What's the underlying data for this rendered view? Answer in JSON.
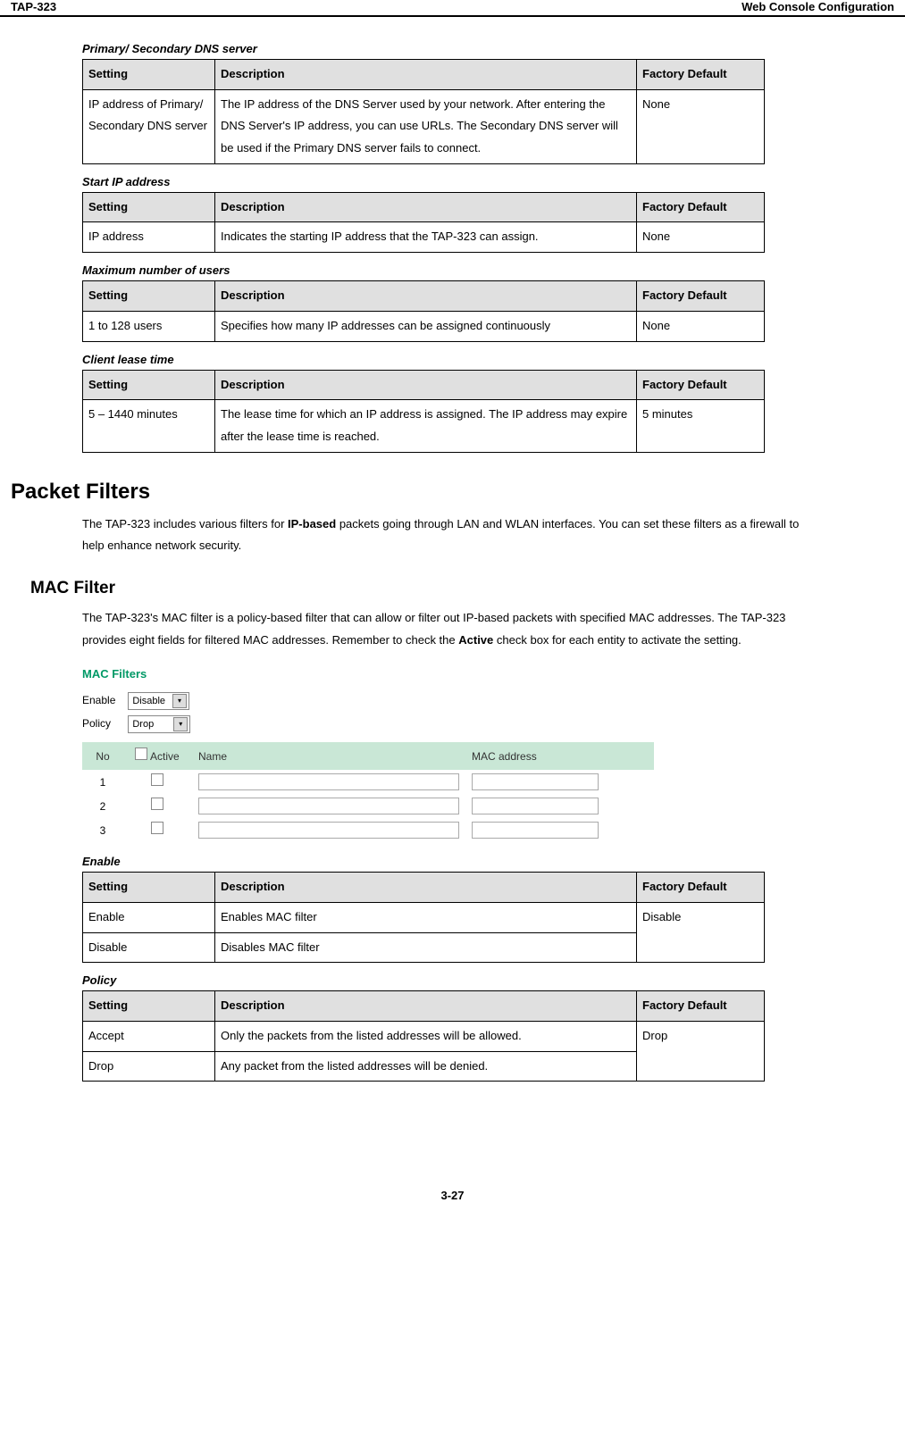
{
  "header": {
    "left": "TAP-323",
    "right": "Web Console Configuration"
  },
  "tables": {
    "headers": {
      "setting": "Setting",
      "description": "Description",
      "default": "Factory Default"
    },
    "dns": {
      "title": "Primary/ Secondary DNS server",
      "setting": "IP address of Primary/ Secondary DNS server",
      "description": "The IP address of the DNS Server used by your network. After entering the DNS Server's IP address, you can use URLs. The Secondary DNS server will be used if the Primary DNS server fails to connect.",
      "default": "None"
    },
    "start_ip": {
      "title": "Start IP address",
      "setting": "IP address",
      "description": "Indicates the starting IP address that the TAP-323 can assign.",
      "default": "None"
    },
    "max_users": {
      "title": "Maximum number of users",
      "setting": "1 to 128 users",
      "description": "Specifies how many IP addresses can be assigned continuously",
      "default": "None"
    },
    "lease": {
      "title": "Client lease time",
      "setting": "5 – 1440 minutes",
      "description": "The lease time for which an IP address is assigned. The IP address may expire after the lease time is reached.",
      "default": "5 minutes"
    },
    "enable": {
      "title": "Enable",
      "rows": [
        {
          "setting": "Enable",
          "description": "Enables MAC filter"
        },
        {
          "setting": "Disable",
          "description": "Disables MAC filter"
        }
      ],
      "default": "Disable"
    },
    "policy": {
      "title": "Policy",
      "rows": [
        {
          "setting": "Accept",
          "description": "Only the packets from the listed addresses will be allowed."
        },
        {
          "setting": "Drop",
          "description": "Any packet from the listed addresses will be denied."
        }
      ],
      "default": "Drop"
    }
  },
  "sections": {
    "packet_filters": {
      "heading": "Packet Filters",
      "para_parts": [
        "The TAP-323 includes various filters for ",
        "IP-based",
        " packets going through LAN and WLAN interfaces. You can set these filters as a firewall to help enhance network security."
      ]
    },
    "mac_filter": {
      "heading": "MAC Filter",
      "para_parts": [
        "The TAP-323's MAC filter is a policy-based filter that can allow or filter out IP-based packets with specified MAC addresses. The TAP-323 provides eight fields for filtered MAC addresses. Remember to check the ",
        "Active",
        " check box for each entity to activate the setting."
      ]
    }
  },
  "mac_ui": {
    "title": "MAC Filters",
    "enable_label": "Enable",
    "enable_value": "Disable",
    "policy_label": "Policy",
    "policy_value": "Drop",
    "columns": {
      "no": "No",
      "active": "Active",
      "name": "Name",
      "mac": "MAC address"
    },
    "rows": [
      {
        "no": "1"
      },
      {
        "no": "2"
      },
      {
        "no": "3"
      }
    ]
  },
  "footer": "3-27"
}
